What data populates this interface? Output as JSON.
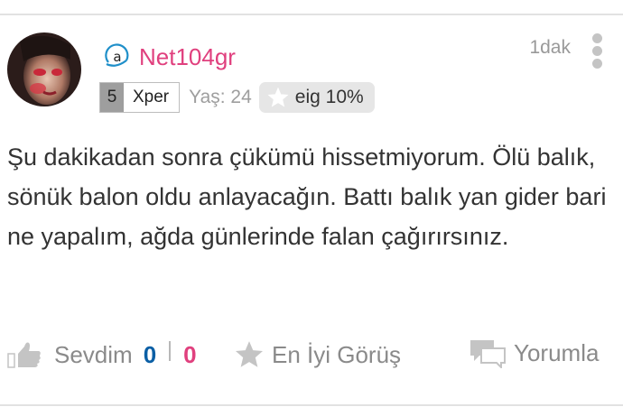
{
  "post": {
    "user": {
      "name": "Net104gr",
      "level_number": "5",
      "level_title": "Xper",
      "age_text": "Yaş: 24",
      "eig_text": "eig 10%"
    },
    "time": "1dak",
    "body": "Şu dakikadan sonra çükümü hissetmiyorum. Ölü balık, sönük balon oldu anlayacağın. Battı balık yan gider bari ne yapalım, ağda günlerinde falan çağırırsınız.",
    "actions": {
      "like_label": "Sevdim",
      "like_count": "0",
      "dislike_count": "0",
      "best_label": "En İyi Görüş",
      "reply_label": "Yorumla"
    }
  },
  "colors": {
    "username": "#e0407e",
    "like_count": "#0b5fa5",
    "dislike_count": "#e0407e",
    "muted": "#8a8a8a"
  },
  "icons": {
    "user_badge": "at-sign-icon",
    "eig": "star-icon",
    "like": "thumbs-up-icon",
    "best": "star-icon",
    "reply": "speech-bubbles-icon",
    "more": "more-vertical-icon"
  }
}
